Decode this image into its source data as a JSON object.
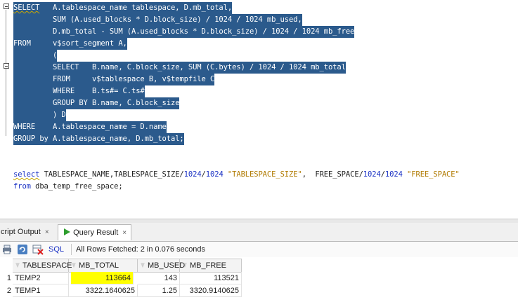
{
  "editor": {
    "lines": [
      {
        "selected": true,
        "parts": [
          {
            "t": "SELECT",
            "c": "kw squig"
          },
          {
            "t": "   A.tablespace_name tablespace, D.mb_total,",
            "c": ""
          }
        ]
      },
      {
        "selected": true,
        "parts": [
          {
            "t": "         SUM (A.used_blocks * D.block_size) / 1024 / 1024 mb_used,",
            "c": ""
          }
        ]
      },
      {
        "selected": true,
        "parts": [
          {
            "t": "         D.mb_total - SUM (A.used_blocks * D.block_size) / 1024 / 1024 mb_free",
            "c": ""
          }
        ]
      },
      {
        "selected": true,
        "parts": [
          {
            "t": "FROM",
            "c": "kw"
          },
          {
            "t": "     v$sort_segment A,",
            "c": ""
          }
        ]
      },
      {
        "selected": true,
        "parts": [
          {
            "t": "         (",
            "c": ""
          }
        ]
      },
      {
        "selected": true,
        "parts": [
          {
            "t": "         SELECT   B.name, C.block_size, SUM (C.bytes) / 1024 / 1024 mb_total",
            "c": ""
          }
        ]
      },
      {
        "selected": true,
        "parts": [
          {
            "t": "         FROM     v$tablespace B, v$tempfile C",
            "c": ""
          }
        ]
      },
      {
        "selected": true,
        "parts": [
          {
            "t": "         WHERE    B.ts#= C.ts#",
            "c": ""
          }
        ]
      },
      {
        "selected": true,
        "parts": [
          {
            "t": "         GROUP BY B.name, C.block_size",
            "c": ""
          }
        ]
      },
      {
        "selected": true,
        "parts": [
          {
            "t": "         ) D",
            "c": ""
          }
        ]
      },
      {
        "selected": true,
        "parts": [
          {
            "t": "WHERE",
            "c": "kw"
          },
          {
            "t": "    A.tablespace_name = D.name",
            "c": ""
          }
        ]
      },
      {
        "selected": true,
        "parts": [
          {
            "t": "GROUP by A.tablespace_name, D.mb_total;",
            "c": ""
          }
        ]
      },
      {
        "selected": false,
        "parts": []
      },
      {
        "selected": false,
        "parts": []
      },
      {
        "selected": false,
        "parts": [
          {
            "t": "select",
            "c": "kw squig"
          },
          {
            "t": " TABLESPACE_NAME,TABLESPACE_SIZE/",
            "c": "txt"
          },
          {
            "t": "1024",
            "c": "num"
          },
          {
            "t": "/",
            "c": "txt"
          },
          {
            "t": "1024",
            "c": "num"
          },
          {
            "t": " ",
            "c": "txt"
          },
          {
            "t": "\"TABLESPACE_SIZE\"",
            "c": "str"
          },
          {
            "t": ",  FREE_SPACE/",
            "c": "txt"
          },
          {
            "t": "1024",
            "c": "num"
          },
          {
            "t": "/",
            "c": "txt"
          },
          {
            "t": "1024",
            "c": "num"
          },
          {
            "t": " ",
            "c": "txt"
          },
          {
            "t": "\"FREE_SPACE\"",
            "c": "str"
          }
        ]
      },
      {
        "selected": false,
        "parts": [
          {
            "t": "from",
            "c": "kw"
          },
          {
            "t": " dba_temp_free_space;",
            "c": "txt"
          }
        ]
      }
    ]
  },
  "tabs": {
    "script_output": "cript Output",
    "query_result": "Query Result",
    "close_glyph": "×"
  },
  "toolbar": {
    "sql_label": "SQL",
    "status": "All Rows Fetched: 2 in 0.076 seconds"
  },
  "grid": {
    "columns": [
      "TABLESPACE",
      "MB_TOTAL",
      "MB_USED",
      "MB_FREE"
    ],
    "rows": [
      {
        "num": "1",
        "cells": [
          "TEMP2",
          "113664",
          "143",
          "113521"
        ]
      },
      {
        "num": "2",
        "cells": [
          "TEMP1",
          "3322.1640625",
          "1.25",
          "3320.9140625"
        ]
      }
    ]
  },
  "colors": {
    "selection": "#2b5a8c",
    "keyword": "#1a31c4",
    "string": "#b07a00",
    "highlight_cell": "#ffff00"
  }
}
